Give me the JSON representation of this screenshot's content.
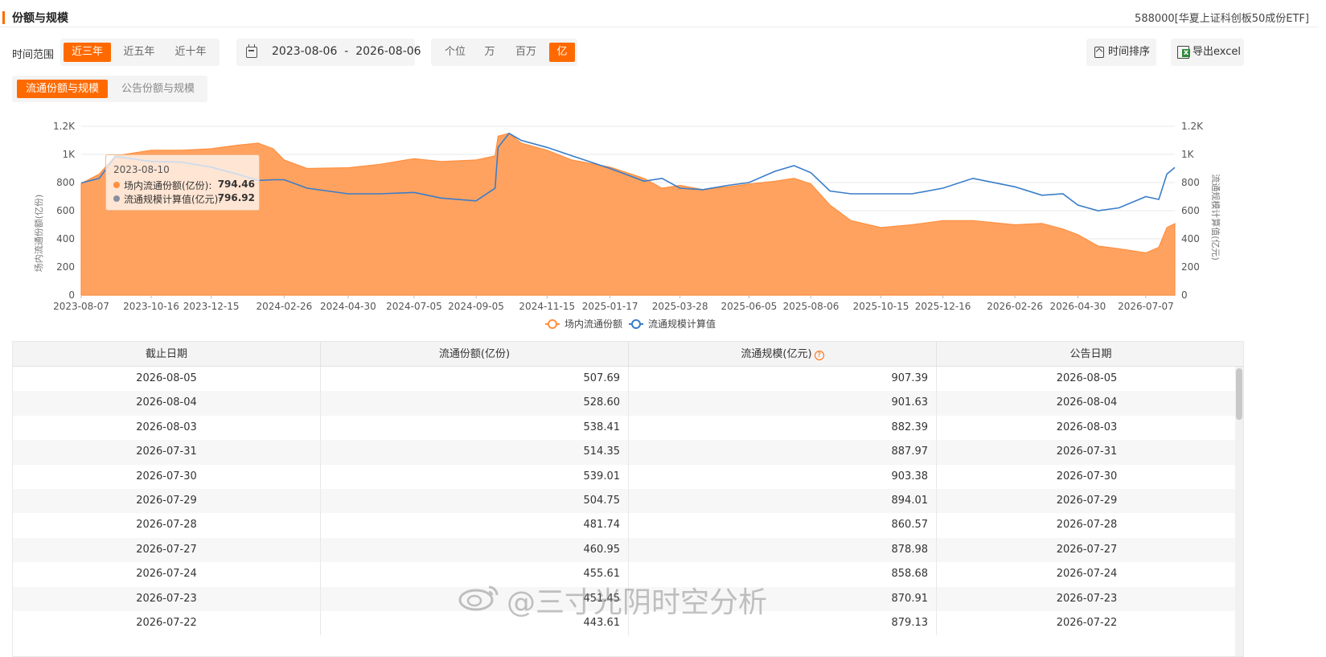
{
  "header": {
    "title": "份额与规模",
    "fund_name": "588000[华夏上证科创板50成份ETF]"
  },
  "toolbar": {
    "range_label": "时间范围",
    "range_options": [
      "近三年",
      "近五年",
      "近十年"
    ],
    "range_selected": 0,
    "date_range": "2023-08-06  -  2026-08-06",
    "unit_options": [
      "个位",
      "万",
      "百万",
      "亿"
    ],
    "unit_selected": 3,
    "sort_label": "时间排序",
    "export_label": "导出excel"
  },
  "subtabs": {
    "options": [
      "流通份额与规模",
      "公告份额与规模"
    ],
    "selected": 0
  },
  "tooltip": {
    "date": "2023-08-10",
    "rows": [
      {
        "name": "场内流通份额(亿份):",
        "value": "794.46",
        "color": "#ff8f3f"
      },
      {
        "name": "流通规模计算值(亿元):",
        "value": "796.92",
        "color": "#8a8fa0"
      }
    ]
  },
  "chart_data": {
    "type": "area",
    "y_left_label": "场内流通份额(亿份)",
    "y_right_label": "流通规模计算值(亿元)",
    "ylim": [
      0,
      1200
    ],
    "y_ticks": [
      "0",
      "200",
      "400",
      "600",
      "800",
      "1K",
      "1.2K"
    ],
    "x_ticks": [
      "2023-08-07",
      "2023-10-16",
      "2023-12-15",
      "2024-02-26",
      "2024-04-30",
      "2024-07-05",
      "2024-09-05",
      "2024-11-15",
      "2025-01-17",
      "2025-03-28",
      "2025-06-05",
      "2025-08-06",
      "2025-10-15",
      "2025-12-16",
      "2026-02-26",
      "2026-04-30",
      "2026-07-07"
    ],
    "legend_position": "bottom-center",
    "series": [
      {
        "name": "场内流通份额",
        "color": "#ff8f3f",
        "x": [
          "2023-08-07",
          "2023-08-25",
          "2023-09-10",
          "2023-10-16",
          "2023-11-15",
          "2023-12-15",
          "2024-01-10",
          "2024-01-31",
          "2024-02-15",
          "2024-02-26",
          "2024-03-20",
          "2024-04-30",
          "2024-06-01",
          "2024-07-05",
          "2024-08-01",
          "2024-09-05",
          "2024-09-24",
          "2024-09-27",
          "2024-10-08",
          "2024-10-20",
          "2024-11-15",
          "2024-12-10",
          "2025-01-17",
          "2025-02-20",
          "2025-03-10",
          "2025-03-28",
          "2025-04-20",
          "2025-05-15",
          "2025-06-05",
          "2025-07-01",
          "2025-07-20",
          "2025-08-06",
          "2025-08-25",
          "2025-09-15",
          "2025-10-15",
          "2025-11-15",
          "2025-12-16",
          "2026-01-15",
          "2026-02-26",
          "2026-03-25",
          "2026-04-15",
          "2026-04-30",
          "2026-05-20",
          "2026-06-10",
          "2026-07-07",
          "2026-07-20",
          "2026-07-28",
          "2026-08-05"
        ],
        "values": [
          794,
          860,
          990,
          1030,
          1030,
          1040,
          1065,
          1080,
          1040,
          960,
          900,
          905,
          930,
          970,
          950,
          960,
          990,
          1130,
          1150,
          1080,
          1030,
          960,
          910,
          830,
          760,
          780,
          750,
          770,
          790,
          810,
          830,
          790,
          640,
          530,
          480,
          500,
          530,
          530,
          500,
          510,
          470,
          430,
          350,
          330,
          300,
          340,
          480,
          508
        ]
      },
      {
        "name": "流通规模计算值",
        "color": "#3a7dc9",
        "x": [
          "2023-08-07",
          "2023-08-25",
          "2023-09-10",
          "2023-10-16",
          "2023-11-15",
          "2023-12-15",
          "2024-01-10",
          "2024-01-31",
          "2024-02-15",
          "2024-02-26",
          "2024-03-20",
          "2024-04-30",
          "2024-06-01",
          "2024-07-05",
          "2024-08-01",
          "2024-09-05",
          "2024-09-24",
          "2024-09-27",
          "2024-10-08",
          "2024-10-20",
          "2024-11-15",
          "2024-12-10",
          "2025-01-17",
          "2025-02-20",
          "2025-03-10",
          "2025-03-28",
          "2025-04-20",
          "2025-05-15",
          "2025-06-05",
          "2025-07-01",
          "2025-07-20",
          "2025-08-06",
          "2025-08-25",
          "2025-09-15",
          "2025-10-15",
          "2025-11-15",
          "2025-12-16",
          "2026-01-15",
          "2026-02-26",
          "2026-03-25",
          "2026-04-15",
          "2026-04-30",
          "2026-05-20",
          "2026-06-10",
          "2026-07-07",
          "2026-07-20",
          "2026-07-28",
          "2026-08-05"
        ],
        "values": [
          797,
          830,
          985,
          950,
          945,
          910,
          860,
          815,
          820,
          820,
          760,
          720,
          720,
          730,
          690,
          670,
          760,
          1050,
          1150,
          1100,
          1050,
          990,
          900,
          810,
          830,
          760,
          750,
          780,
          800,
          880,
          920,
          870,
          740,
          720,
          720,
          720,
          760,
          830,
          770,
          710,
          720,
          640,
          600,
          620,
          700,
          680,
          860,
          907
        ]
      }
    ]
  },
  "table": {
    "headers": [
      "截止日期",
      "流通份额(亿份)",
      "流通规模(亿元)",
      "公告日期"
    ],
    "help_icon": "?",
    "rows": [
      [
        "2026-08-05",
        "507.69",
        "907.39",
        "2026-08-05"
      ],
      [
        "2026-08-04",
        "528.60",
        "901.63",
        "2026-08-04"
      ],
      [
        "2026-08-03",
        "538.41",
        "882.39",
        "2026-08-03"
      ],
      [
        "2026-07-31",
        "514.35",
        "887.97",
        "2026-07-31"
      ],
      [
        "2026-07-30",
        "539.01",
        "903.38",
        "2026-07-30"
      ],
      [
        "2026-07-29",
        "504.75",
        "894.01",
        "2026-07-29"
      ],
      [
        "2026-07-28",
        "481.74",
        "860.57",
        "2026-07-28"
      ],
      [
        "2026-07-27",
        "460.95",
        "878.98",
        "2026-07-27"
      ],
      [
        "2026-07-24",
        "455.61",
        "858.68",
        "2026-07-24"
      ],
      [
        "2026-07-23",
        "451.45",
        "870.91",
        "2026-07-23"
      ],
      [
        "2026-07-22",
        "443.61",
        "879.13",
        "2026-07-22"
      ]
    ]
  },
  "watermark": {
    "text": "@三寸光阴时空分析"
  },
  "colors": {
    "accent": "#ff6a00",
    "area": "#ff9a52",
    "line": "#3a7dc9"
  }
}
